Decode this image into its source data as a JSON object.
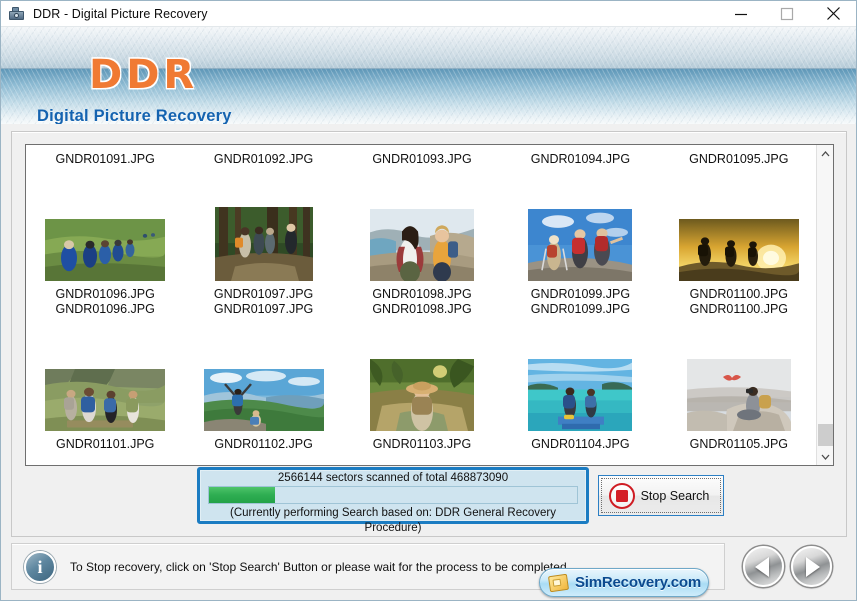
{
  "window": {
    "title": "DDR - Digital Picture Recovery",
    "icon": "camera-icon",
    "controls": {
      "minimize": "minimize-icon",
      "maximize": "maximize-icon",
      "close": "close-icon"
    }
  },
  "banner": {
    "logo": "DDR",
    "subtitle": "Digital Picture Recovery",
    "logo_color": "#f07a33",
    "subtitle_color": "#1463b0"
  },
  "thumbnails": {
    "rows": [
      {
        "captions_top": [
          "GNDR01091.JPG",
          "GNDR01092.JPG",
          "GNDR01093.JPG",
          "GNDR01094.JPG",
          "GNDR01095.JPG"
        ],
        "captions_bottom": [
          "GNDR01096.JPG",
          "GNDR01097.JPG",
          "GNDR01098.JPG",
          "GNDR01099.JPG",
          "GNDR01100.JPG"
        ],
        "images": [
          "hikers-green-field",
          "hikers-forest-trail",
          "two-women-coastal-hike",
          "backpackers-rocky-summit",
          "hikers-golden-sunset-ridge"
        ]
      },
      {
        "captions_top": [
          "GNDR01096.JPG",
          "GNDR01097.JPG",
          "GNDR01098.JPG",
          "GNDR01099.JPG",
          "GNDR01100.JPG"
        ],
        "captions_bottom": [
          "GNDR01101.JPG",
          "GNDR01102.JPG",
          "GNDR01103.JPG",
          "GNDR01104.JPG",
          "GNDR01105.JPG"
        ],
        "images": [
          "hikers-mountain-valley-path",
          "hiker-arms-raised-viewpoint",
          "traveler-jungle-path-hat",
          "two-men-turquoise-lagoon-pier",
          "photographer-on-rock-bird"
        ]
      }
    ],
    "scrollbar": {
      "up_arrow": "chevron-up-icon",
      "down_arrow": "chevron-down-icon"
    }
  },
  "progress": {
    "label": "2566144 sectors scanned of total 468873090",
    "note": "(Currently performing Search based on:  DDR General Recovery Procedure)",
    "sectors_scanned": 2566144,
    "sectors_total": 468873090,
    "fill_percent": 18,
    "fill_color": "#2fae52",
    "border_color": "#1b7cc2"
  },
  "stop_button": {
    "label": "Stop Search",
    "icon": "stop-icon",
    "icon_color": "#d41f26"
  },
  "status": {
    "icon": "info-icon",
    "text": "To Stop recovery, click on 'Stop Search' Button or please wait for the process to be completed."
  },
  "branding": {
    "badge_text": "SimRecovery.com",
    "badge_icon": "sim-card-icon",
    "badge_text_color": "#0b4a8f"
  },
  "navigation": {
    "prev": "previous-arrow-icon",
    "next": "next-arrow-icon"
  }
}
